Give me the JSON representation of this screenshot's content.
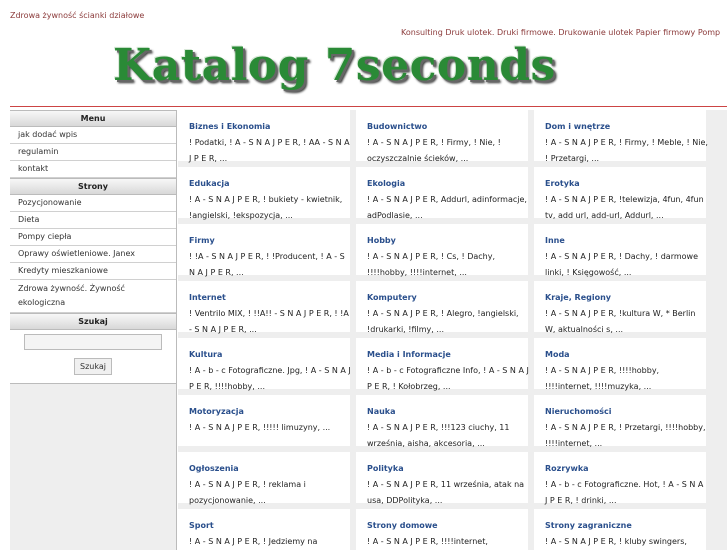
{
  "header": {
    "top_link": "Zdrowa żywność ścianki działowe",
    "marquee": "Konsulting Druk ulotek. Druki firmowe. Drukowanie ulotek Papier firmowy Pomp",
    "logo_text": "Katalog 7seconds"
  },
  "sidebar": {
    "menu_title": "Menu",
    "menu_items": [
      "jak dodać wpis",
      "regulamin",
      "kontakt"
    ],
    "pages_title": "Strony",
    "page_items": [
      "Pozycjonowanie",
      "Dieta",
      "Pompy ciepła",
      "Oprawy oświetleniowe. Janex",
      "Kredyty mieszkaniowe",
      "Zdrowa żywność. Żywność ekologiczna"
    ],
    "search_title": "Szukaj",
    "search_button": "Szukaj"
  },
  "categories": [
    {
      "name": "Biznes i Ekonomia",
      "sub": "! Podatki, ! A - S N A J P E R, ! AA - S N A J P E R, ..."
    },
    {
      "name": "Budownictwo",
      "sub": "! A - S N A J P E R, ! Firmy, ! Nie, ! oczyszczalnie ścieków, ..."
    },
    {
      "name": "Dom i wnętrze",
      "sub": "! A - S N A J P E R, ! Firmy, ! Meble, ! Nie, ! Przetargi, ..."
    },
    {
      "name": "Edukacja",
      "sub": "! A - S N A J P E R, ! bukiety - kwietnik, !angielski, !ekspozycja, ..."
    },
    {
      "name": "Ekologia",
      "sub": "! A - S N A J P E R, Addurl, adinformacje, adPodlasie, ..."
    },
    {
      "name": "Erotyka",
      "sub": "! A - S N A J P E R, !telewizja, 4fun, 4fun tv, add url, add-url, Addurl, ..."
    },
    {
      "name": "Firmy",
      "sub": "! !A - S N A J P E R, ! !Producent, ! A - S N A J P E R, ..."
    },
    {
      "name": "Hobby",
      "sub": "! A - S N A J P E R, ! Cs, ! Dachy, !!!!hobby, !!!!internet, ..."
    },
    {
      "name": "Inne",
      "sub": "! A - S N A J P E R, ! Dachy, ! darmowe linki, ! Księgowość, ..."
    },
    {
      "name": "Internet",
      "sub": "! Ventrilo MIX, ! !!A!! - S N A J P E R, ! !A - S N A J P E R, ..."
    },
    {
      "name": "Komputery",
      "sub": "! A - S N A J P E R, ! Alegro, !angielski, !drukarki, !filmy, ..."
    },
    {
      "name": "Kraje, Regiony",
      "sub": "! A - S N A J P E R, !kultura W, * Berlin W, aktualności s, ..."
    },
    {
      "name": "Kultura",
      "sub": "! A - b - c Fotograficzne. Jpg, ! A - S N A J P E R, !!!!hobby, ..."
    },
    {
      "name": "Media i Informacje",
      "sub": "! A - b - c Fotograficzne Info, ! A - S N A J P E R, ! Kołobrzeg, ..."
    },
    {
      "name": "Moda",
      "sub": "! A - S N A J P E R, !!!!hobby, !!!!internet, !!!!muzyka, ..."
    },
    {
      "name": "Motoryzacja",
      "sub": "! A - S N A J P E R, !!!!! limuzyny, ..."
    },
    {
      "name": "Nauka",
      "sub": "! A - S N A J P E R, !!!123 ciuchy, 11 września, aisha, akcesoria, ..."
    },
    {
      "name": "Nieruchomości",
      "sub": "! A - S N A J P E R, ! Przetargi, !!!!hobby, !!!!internet, ..."
    },
    {
      "name": "Ogłoszenia",
      "sub": "! A - S N A J P E R, ! reklama i pozycjonowanie, ..."
    },
    {
      "name": "Polityka",
      "sub": "! A - S N A J P E R, 11 września, atak na usa, DDPolityka, ..."
    },
    {
      "name": "Rozrywka",
      "sub": "! A - b - c Fotograficzne. Hot, ! A - S N A J P E R, ! drinki, ..."
    },
    {
      "name": "Sport",
      "sub": "! A - S N A J P E R, ! Jedziemy na"
    },
    {
      "name": "Strony domowe",
      "sub": "! A - S N A J P E R, !!!!internet,"
    },
    {
      "name": "Strony zagraniczne",
      "sub": "! A - S N A J P E R, ! kluby swingers,"
    }
  ],
  "colors": {
    "accent_link": "#2a4f8c",
    "header_link": "#8b3a3a",
    "divider": "#cc4444",
    "logo": "#2a8a36"
  }
}
